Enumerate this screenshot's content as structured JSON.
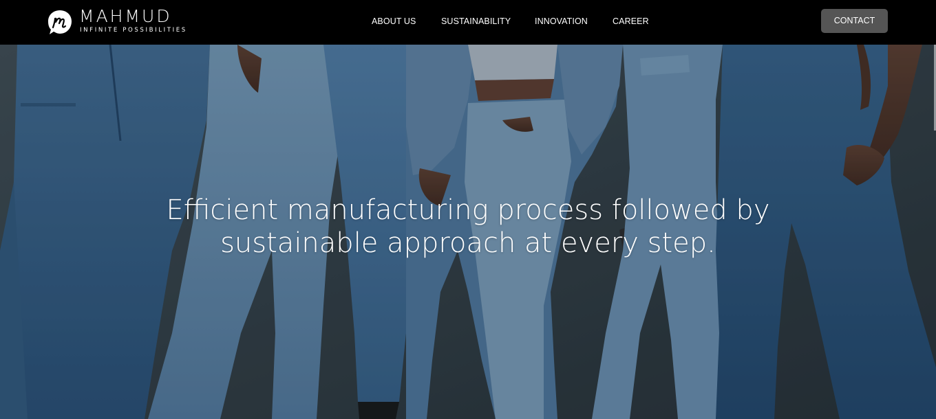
{
  "brand": {
    "name": "MAHMUD",
    "tagline": "INFINITE POSSIBILITIES",
    "logo_icon": "m-monogram-icon"
  },
  "nav": {
    "items": [
      {
        "label": "ABOUT US"
      },
      {
        "label": "SUSTAINABILITY"
      },
      {
        "label": "INNOVATION"
      },
      {
        "label": "CAREER"
      }
    ],
    "contact_label": "CONTACT"
  },
  "hero": {
    "headline_line1": "Efficient manufacturing process followed by",
    "headline_line2": "sustainable approach at every step.",
    "image_subject": "group of people wearing blue denim jeans"
  },
  "colors": {
    "header_bg": "#000000",
    "contact_bg": "#555555",
    "denim_light": "#7fa6c9",
    "denim_mid": "#4f7fab",
    "denim_dark": "#2c4f73",
    "backdrop": "#3c4850"
  }
}
